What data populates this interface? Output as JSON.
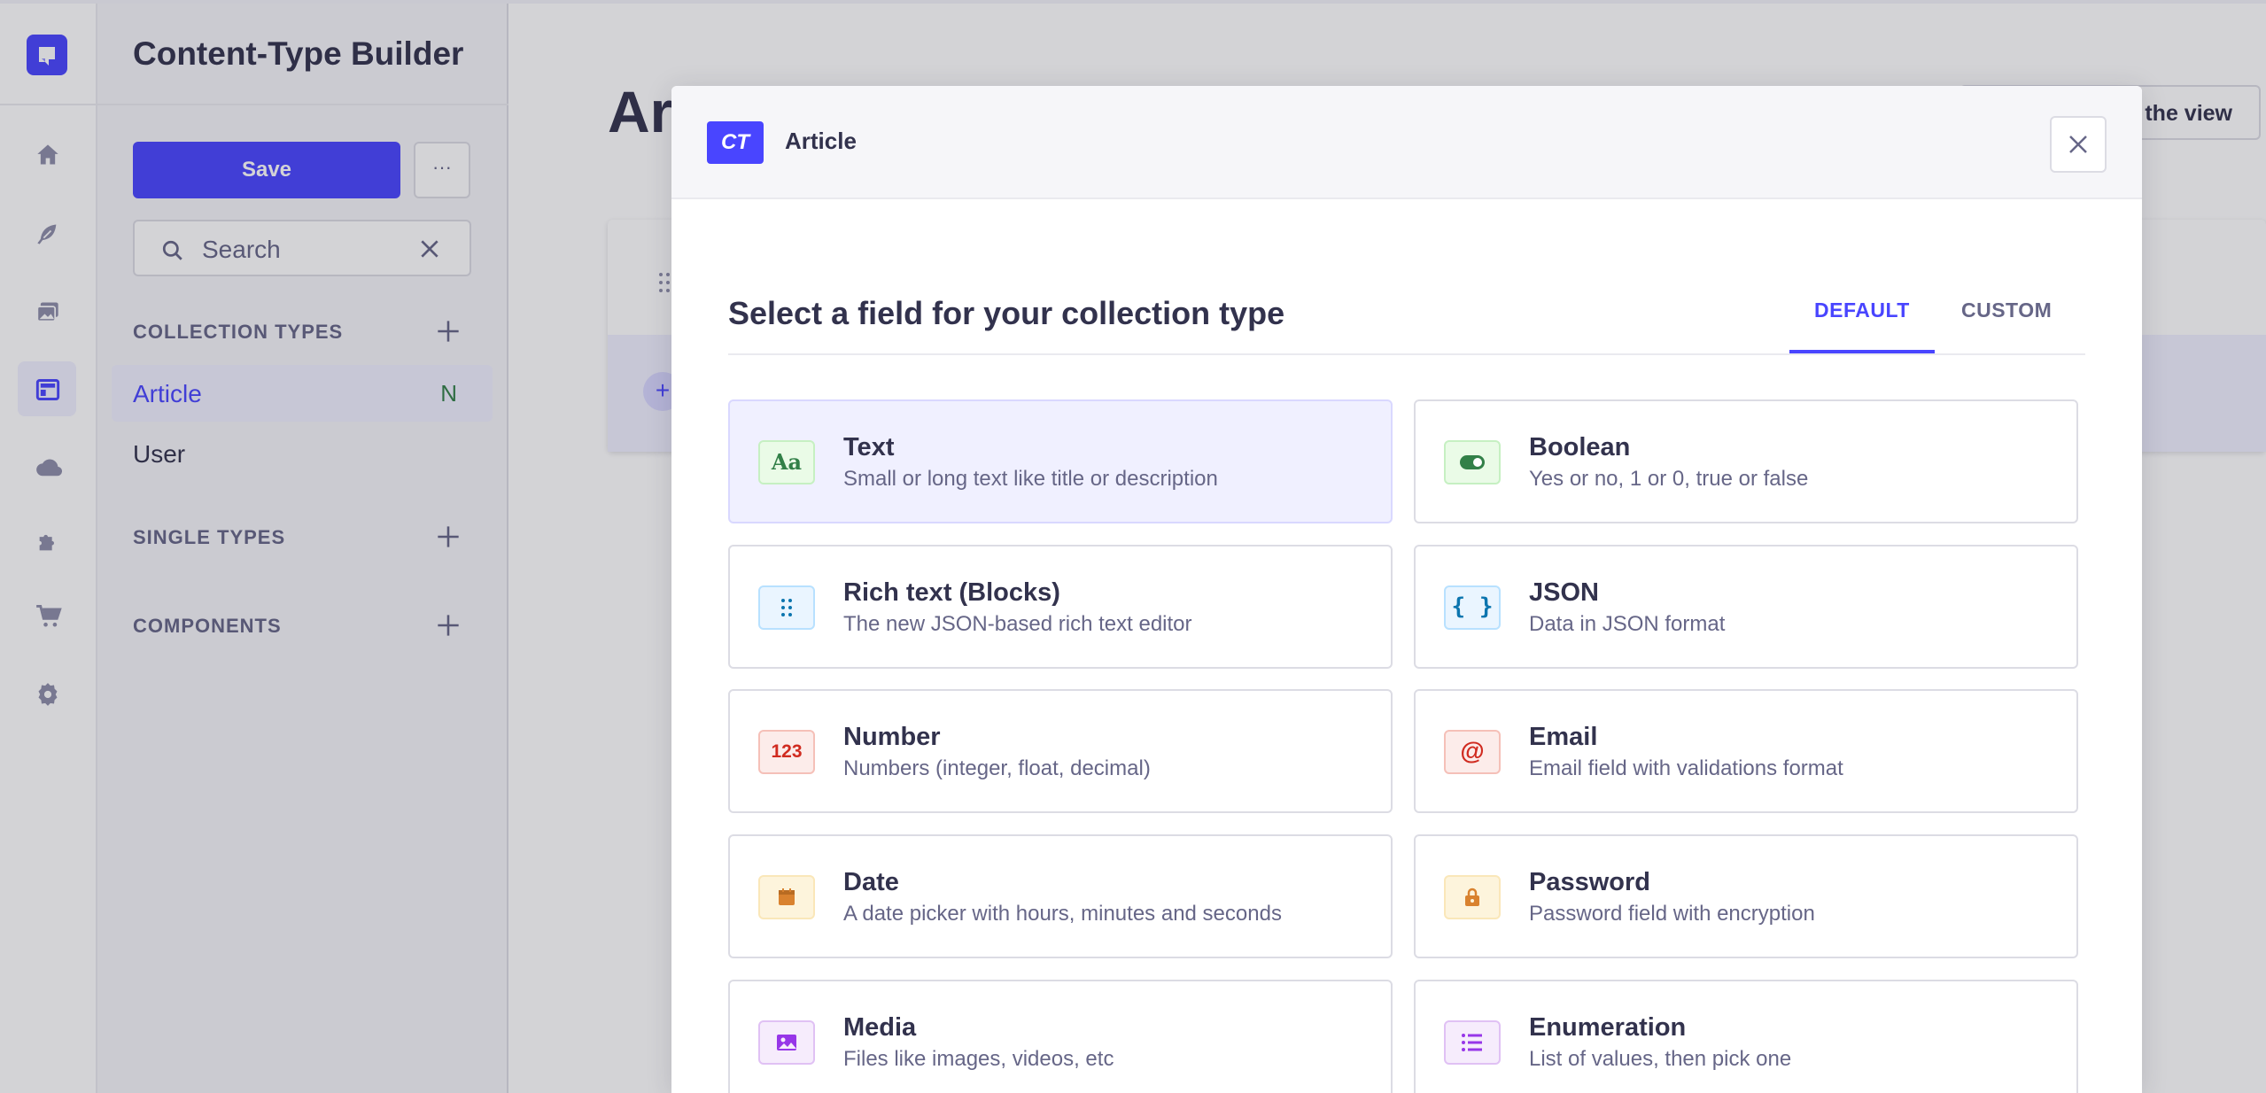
{
  "sidebar": {
    "title": "Content-Type Builder",
    "save_label": "Save",
    "more_label": "···",
    "search_placeholder": "Search",
    "collection_types_header": "COLLECTION TYPES",
    "collection_types": [
      {
        "label": "Article",
        "badge": "N",
        "active": true
      },
      {
        "label": "User",
        "badge": "",
        "active": false
      }
    ],
    "single_types_header": "SINGLE TYPES",
    "components_header": "COMPONENTS"
  },
  "rail_icons": [
    "home-icon",
    "feather-icon",
    "media-library-icon",
    "content-type-builder-icon",
    "cloud-icon",
    "puzzle-icon",
    "cart-icon",
    "gear-icon"
  ],
  "background": {
    "page_title": "Art",
    "view_button_label": "the view"
  },
  "modal": {
    "badge": "CT",
    "breadcrumb": "Article",
    "title": "Select a field for your collection type",
    "tabs": [
      {
        "label": "DEFAULT",
        "active": true
      },
      {
        "label": "CUSTOM",
        "active": false
      }
    ],
    "fields": [
      {
        "title": "Text",
        "description": "Small or long text like title or description",
        "icon": "text-icon",
        "icon_text": "Aa",
        "color": "#328048"
      },
      {
        "title": "Boolean",
        "description": "Yes or no, 1 or 0, true or false",
        "icon": "toggle-icon",
        "icon_text": "",
        "color": "#328048"
      },
      {
        "title": "Rich text (Blocks)",
        "description": "The new JSON-based rich text editor",
        "icon": "blocks-icon",
        "icon_text": "",
        "color": "#0c75af"
      },
      {
        "title": "JSON",
        "description": "Data in JSON format",
        "icon": "json-icon",
        "icon_text": "{ }",
        "color": "#0c75af"
      },
      {
        "title": "Number",
        "description": "Numbers (integer, float, decimal)",
        "icon": "number-icon",
        "icon_text": "123",
        "color": "#d02b20"
      },
      {
        "title": "Email",
        "description": "Email field with validations format",
        "icon": "at-icon",
        "icon_text": "@",
        "color": "#d02b20"
      },
      {
        "title": "Date",
        "description": "A date picker with hours, minutes and seconds",
        "icon": "calendar-icon",
        "icon_text": "",
        "color": "#d9822f"
      },
      {
        "title": "Password",
        "description": "Password field with encryption",
        "icon": "lock-icon",
        "icon_text": "",
        "color": "#d9822f"
      },
      {
        "title": "Media",
        "description": "Files like images, videos, etc",
        "icon": "image-icon",
        "icon_text": "",
        "color": "#9736e8"
      },
      {
        "title": "Enumeration",
        "description": "List of values, then pick one",
        "icon": "list-icon",
        "icon_text": "",
        "color": "#9736e8"
      }
    ]
  }
}
